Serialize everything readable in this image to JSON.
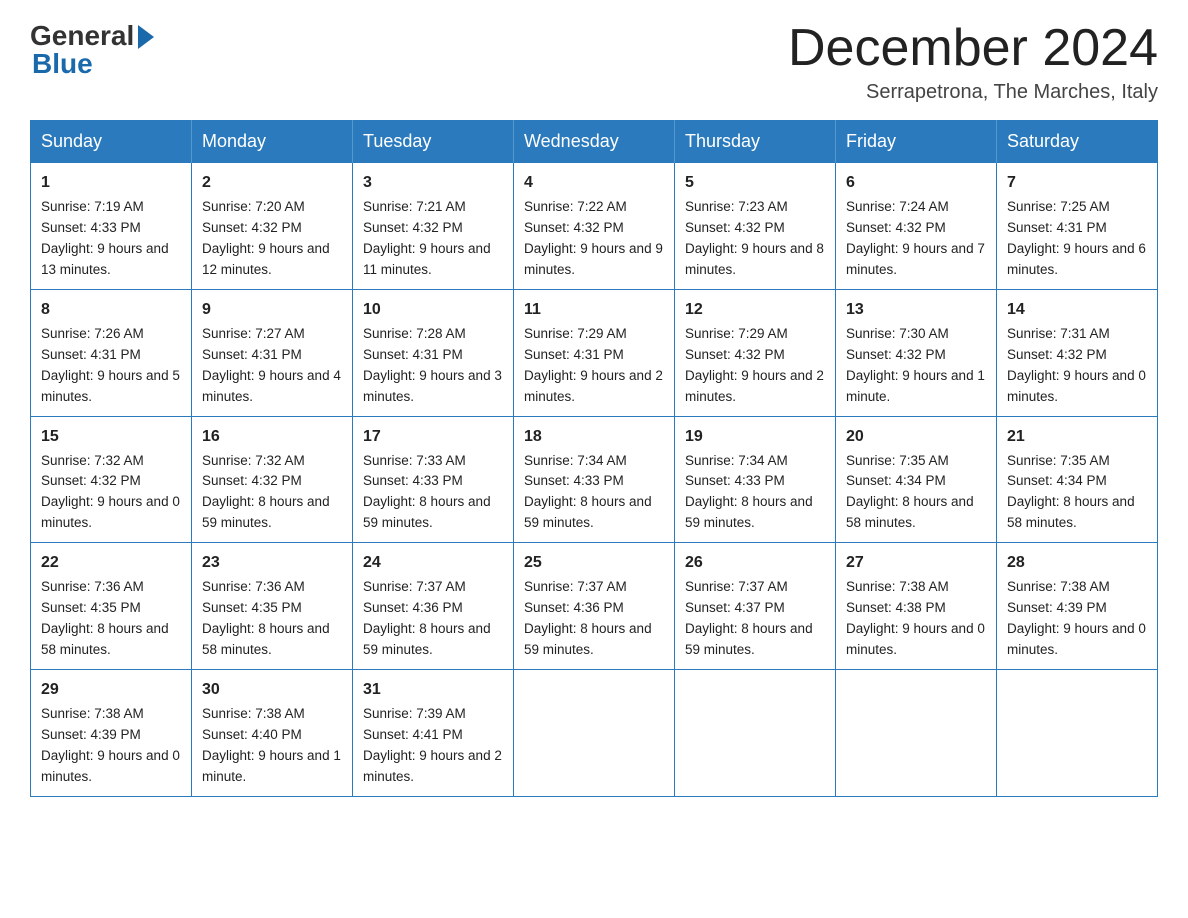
{
  "header": {
    "logo": {
      "general": "General",
      "blue": "Blue"
    },
    "title": "December 2024",
    "subtitle": "Serrapetrona, The Marches, Italy"
  },
  "days_of_week": [
    "Sunday",
    "Monday",
    "Tuesday",
    "Wednesday",
    "Thursday",
    "Friday",
    "Saturday"
  ],
  "weeks": [
    [
      {
        "day": "1",
        "sunrise": "7:19 AM",
        "sunset": "4:33 PM",
        "daylight": "9 hours and 13 minutes."
      },
      {
        "day": "2",
        "sunrise": "7:20 AM",
        "sunset": "4:32 PM",
        "daylight": "9 hours and 12 minutes."
      },
      {
        "day": "3",
        "sunrise": "7:21 AM",
        "sunset": "4:32 PM",
        "daylight": "9 hours and 11 minutes."
      },
      {
        "day": "4",
        "sunrise": "7:22 AM",
        "sunset": "4:32 PM",
        "daylight": "9 hours and 9 minutes."
      },
      {
        "day": "5",
        "sunrise": "7:23 AM",
        "sunset": "4:32 PM",
        "daylight": "9 hours and 8 minutes."
      },
      {
        "day": "6",
        "sunrise": "7:24 AM",
        "sunset": "4:32 PM",
        "daylight": "9 hours and 7 minutes."
      },
      {
        "day": "7",
        "sunrise": "7:25 AM",
        "sunset": "4:31 PM",
        "daylight": "9 hours and 6 minutes."
      }
    ],
    [
      {
        "day": "8",
        "sunrise": "7:26 AM",
        "sunset": "4:31 PM",
        "daylight": "9 hours and 5 minutes."
      },
      {
        "day": "9",
        "sunrise": "7:27 AM",
        "sunset": "4:31 PM",
        "daylight": "9 hours and 4 minutes."
      },
      {
        "day": "10",
        "sunrise": "7:28 AM",
        "sunset": "4:31 PM",
        "daylight": "9 hours and 3 minutes."
      },
      {
        "day": "11",
        "sunrise": "7:29 AM",
        "sunset": "4:31 PM",
        "daylight": "9 hours and 2 minutes."
      },
      {
        "day": "12",
        "sunrise": "7:29 AM",
        "sunset": "4:32 PM",
        "daylight": "9 hours and 2 minutes."
      },
      {
        "day": "13",
        "sunrise": "7:30 AM",
        "sunset": "4:32 PM",
        "daylight": "9 hours and 1 minute."
      },
      {
        "day": "14",
        "sunrise": "7:31 AM",
        "sunset": "4:32 PM",
        "daylight": "9 hours and 0 minutes."
      }
    ],
    [
      {
        "day": "15",
        "sunrise": "7:32 AM",
        "sunset": "4:32 PM",
        "daylight": "9 hours and 0 minutes."
      },
      {
        "day": "16",
        "sunrise": "7:32 AM",
        "sunset": "4:32 PM",
        "daylight": "8 hours and 59 minutes."
      },
      {
        "day": "17",
        "sunrise": "7:33 AM",
        "sunset": "4:33 PM",
        "daylight": "8 hours and 59 minutes."
      },
      {
        "day": "18",
        "sunrise": "7:34 AM",
        "sunset": "4:33 PM",
        "daylight": "8 hours and 59 minutes."
      },
      {
        "day": "19",
        "sunrise": "7:34 AM",
        "sunset": "4:33 PM",
        "daylight": "8 hours and 59 minutes."
      },
      {
        "day": "20",
        "sunrise": "7:35 AM",
        "sunset": "4:34 PM",
        "daylight": "8 hours and 58 minutes."
      },
      {
        "day": "21",
        "sunrise": "7:35 AM",
        "sunset": "4:34 PM",
        "daylight": "8 hours and 58 minutes."
      }
    ],
    [
      {
        "day": "22",
        "sunrise": "7:36 AM",
        "sunset": "4:35 PM",
        "daylight": "8 hours and 58 minutes."
      },
      {
        "day": "23",
        "sunrise": "7:36 AM",
        "sunset": "4:35 PM",
        "daylight": "8 hours and 58 minutes."
      },
      {
        "day": "24",
        "sunrise": "7:37 AM",
        "sunset": "4:36 PM",
        "daylight": "8 hours and 59 minutes."
      },
      {
        "day": "25",
        "sunrise": "7:37 AM",
        "sunset": "4:36 PM",
        "daylight": "8 hours and 59 minutes."
      },
      {
        "day": "26",
        "sunrise": "7:37 AM",
        "sunset": "4:37 PM",
        "daylight": "8 hours and 59 minutes."
      },
      {
        "day": "27",
        "sunrise": "7:38 AM",
        "sunset": "4:38 PM",
        "daylight": "9 hours and 0 minutes."
      },
      {
        "day": "28",
        "sunrise": "7:38 AM",
        "sunset": "4:39 PM",
        "daylight": "9 hours and 0 minutes."
      }
    ],
    [
      {
        "day": "29",
        "sunrise": "7:38 AM",
        "sunset": "4:39 PM",
        "daylight": "9 hours and 0 minutes."
      },
      {
        "day": "30",
        "sunrise": "7:38 AM",
        "sunset": "4:40 PM",
        "daylight": "9 hours and 1 minute."
      },
      {
        "day": "31",
        "sunrise": "7:39 AM",
        "sunset": "4:41 PM",
        "daylight": "9 hours and 2 minutes."
      },
      null,
      null,
      null,
      null
    ]
  ]
}
